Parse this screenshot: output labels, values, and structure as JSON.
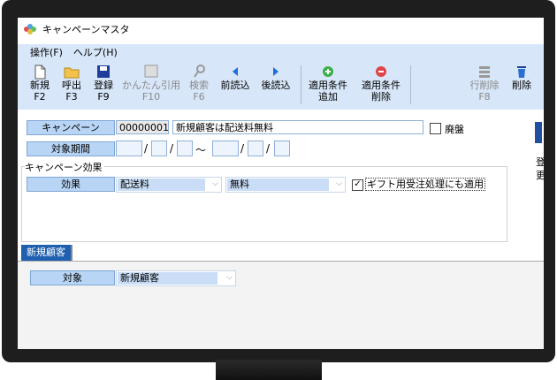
{
  "window": {
    "title": "キャンペーンマスタ"
  },
  "menu": {
    "items": [
      "操作(F)",
      "ヘルプ(H)"
    ]
  },
  "toolbar": {
    "new": {
      "label": "新規",
      "key": "F2"
    },
    "call": {
      "label": "呼出",
      "key": "F3"
    },
    "register": {
      "label": "登録",
      "key": "F9"
    },
    "simple_ref": {
      "label": "かんたん引用",
      "key": "F10"
    },
    "search": {
      "label": "検索",
      "key": "F6"
    },
    "prev": {
      "label": "前読込"
    },
    "next": {
      "label": "後読込"
    },
    "apply_add": {
      "label1": "適用条件",
      "label2": "追加"
    },
    "apply_del": {
      "label1": "適用条件",
      "label2": "削除"
    },
    "row_delete": {
      "label": "行削除",
      "key": "F8"
    },
    "delete": {
      "label": "削除"
    }
  },
  "form": {
    "campaign_label": "キャンペーン",
    "campaign_code": "00000001",
    "campaign_name": "新規顧客は配送料無料",
    "discontinued_label": "廃盤",
    "discontinued_checked": false,
    "period_label": "対象期間",
    "slash": "/",
    "tilde": "～",
    "effect_group_label": "キャンペーン効果",
    "effect_label": "効果",
    "effect_type": "配送料",
    "effect_value": "無料",
    "gift_label": "ギフト用受注処理にも適用",
    "gift_checked": true,
    "gift_check_mark": "✓"
  },
  "tab": {
    "name": "新規顧客"
  },
  "target": {
    "label": "対象",
    "value": "新規顧客"
  },
  "side_cut": {
    "line1": "登",
    "line2": "更"
  }
}
